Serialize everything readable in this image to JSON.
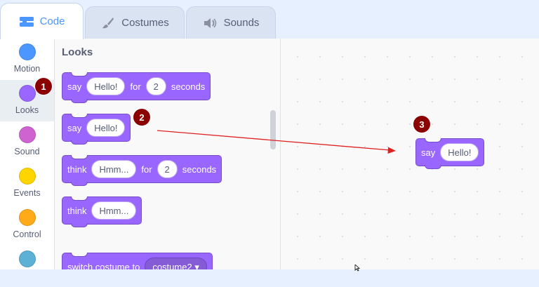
{
  "tabs": [
    {
      "label": "Code",
      "icon": "code-icon"
    },
    {
      "label": "Costumes",
      "icon": "brush-icon"
    },
    {
      "label": "Sounds",
      "icon": "speaker-icon"
    }
  ],
  "categories": [
    {
      "label": "Motion",
      "color": "#4c97ff"
    },
    {
      "label": "Looks",
      "color": "#9966ff"
    },
    {
      "label": "Sound",
      "color": "#cf63cf"
    },
    {
      "label": "Events",
      "color": "#ffd500"
    },
    {
      "label": "Control",
      "color": "#ffab19"
    },
    {
      "label": "",
      "color": "#5cb1d6"
    }
  ],
  "palette": {
    "title": "Looks",
    "blocks": {
      "say_for": {
        "word1": "say",
        "message": "Hello!",
        "word2": "for",
        "secs": "2",
        "word3": "seconds"
      },
      "say": {
        "word1": "say",
        "message": "Hello!"
      },
      "think_for": {
        "word1": "think",
        "message": "Hmm...",
        "word2": "for",
        "secs": "2",
        "word3": "seconds"
      },
      "think": {
        "word1": "think",
        "message": "Hmm..."
      },
      "switch_costume": {
        "word1": "switch costume to",
        "costume": "costume2"
      }
    }
  },
  "script": {
    "say": {
      "word1": "say",
      "message": "Hello!"
    }
  },
  "annotations": {
    "badge1": "1",
    "badge2": "2",
    "badge3": "3"
  },
  "colors": {
    "looks": "#9966ff",
    "accent": "#4c97ff",
    "badge": "#8b0000",
    "arrow": "#e02020"
  }
}
